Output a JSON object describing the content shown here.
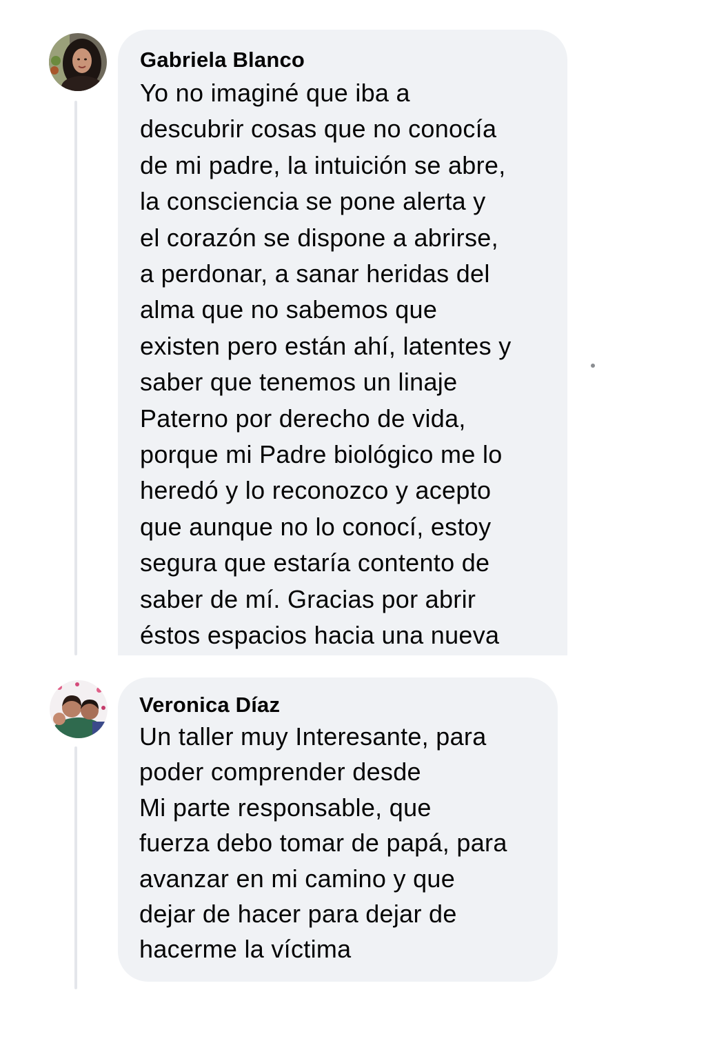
{
  "comments": [
    {
      "author": "Gabriela Blanco",
      "avatar_icon": "profile-photo-gabriela",
      "text": "Yo no imaginé que iba a\ndescubrir cosas que no conocía\nde mi padre, la intuición se abre,\nla consciencia se pone alerta y\nel corazón se dispone a abrirse,\na perdonar, a sanar heridas del\nalma que no sabemos que\nexisten pero están ahí, latentes y\nsaber que tenemos un linaje\nPaterno por derecho de vida,\nporque mi Padre biológico me lo\nheredó y lo reconozco y acepto\nque aunque no lo conocí, estoy\nsegura que estaría contento de\nsaber de mí. Gracias por abrir\néstos espacios hacia una nueva"
    },
    {
      "author": "Veronica Díaz",
      "avatar_icon": "profile-photo-veronica",
      "text": "Un taller muy Interesante, para\npoder comprender desde\nMi parte responsable, que\nfuerza debo tomar de papá, para\navanzar en mi camino y que\ndejar de hacer para dejar de\nhacerme la víctima"
    }
  ],
  "colors": {
    "bubble_background": "#f0f2f5",
    "thread_line": "#e4e6eb",
    "text": "#050505"
  }
}
